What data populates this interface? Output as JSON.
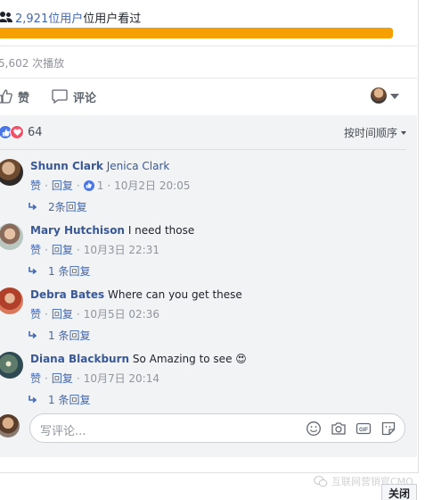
{
  "viewers": {
    "count": "2,921位用户",
    "suffix": "位用户看过",
    "progress_percent": 100
  },
  "plays": "5,602 次播放",
  "actions": {
    "like": "赞",
    "comment": "评论"
  },
  "reactions": {
    "count": "64",
    "sort_label": "按时间顺序"
  },
  "comments": [
    {
      "author": "Shunn Clark",
      "text": "Jenica Clark",
      "like": "赞",
      "reply": "回复",
      "like_count": "1",
      "time": "10月2日 20:05",
      "replies": "2条回复"
    },
    {
      "author": "Mary Hutchison",
      "text": "I need those",
      "like": "赞",
      "reply": "回复",
      "time": "10月3日 22:31",
      "replies": "1 条回复"
    },
    {
      "author": "Debra Bates",
      "text": "Where can you get these",
      "like": "赞",
      "reply": "回复",
      "time": "10月5日 02:36",
      "replies": "1 条回复"
    },
    {
      "author": "Diana Blackburn",
      "text": "So Amazing to see",
      "emoji": "😍",
      "like": "赞",
      "reply": "回复",
      "time": "10月7日 20:14",
      "replies": "1 条回复"
    }
  ],
  "composer": {
    "placeholder": "写评论...",
    "gif": "GIF"
  },
  "close_label": "关闭",
  "watermark": "互联网营销官CMO",
  "colors": {
    "link": "#4267b2",
    "author": "#385898",
    "progress": "#f5a000",
    "panel": "#f2f3f5"
  }
}
